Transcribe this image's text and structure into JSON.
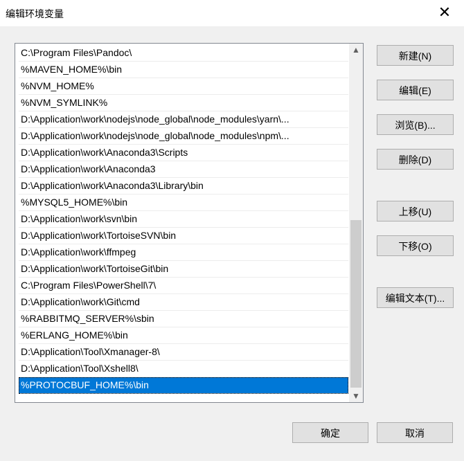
{
  "window": {
    "title": "编辑环境变量",
    "close_glyph": "✕"
  },
  "path_list": {
    "items": [
      "C:\\Program Files\\Pandoc\\",
      "%MAVEN_HOME%\\bin",
      "%NVM_HOME%",
      "%NVM_SYMLINK%",
      "D:\\Application\\work\\nodejs\\node_global\\node_modules\\yarn\\...",
      "D:\\Application\\work\\nodejs\\node_global\\node_modules\\npm\\...",
      "D:\\Application\\work\\Anaconda3\\Scripts",
      "D:\\Application\\work\\Anaconda3",
      "D:\\Application\\work\\Anaconda3\\Library\\bin",
      "%MYSQL5_HOME%\\bin",
      "D:\\Application\\work\\svn\\bin",
      "D:\\Application\\work\\TortoiseSVN\\bin",
      "D:\\Application\\work\\ffmpeg",
      "D:\\Application\\work\\TortoiseGit\\bin",
      "C:\\Program Files\\PowerShell\\7\\",
      "D:\\Application\\work\\Git\\cmd",
      "%RABBITMQ_SERVER%\\sbin",
      "%ERLANG_HOME%\\bin",
      "D:\\Application\\Tool\\Xmanager-8\\",
      "D:\\Application\\Tool\\Xshell8\\",
      "%PROTOCBUF_HOME%\\bin"
    ],
    "selected_item": "%PROTOCBUF_HOME%\\bin"
  },
  "buttons": {
    "new": "新建(N)",
    "edit": "编辑(E)",
    "browse": "浏览(B)...",
    "delete": "删除(D)",
    "move_up": "上移(U)",
    "move_down": "下移(O)",
    "edit_text": "编辑文本(T)...",
    "ok": "确定",
    "cancel": "取消"
  },
  "colors": {
    "selection": "#0078d7",
    "window_bg": "#f0f0f0"
  }
}
